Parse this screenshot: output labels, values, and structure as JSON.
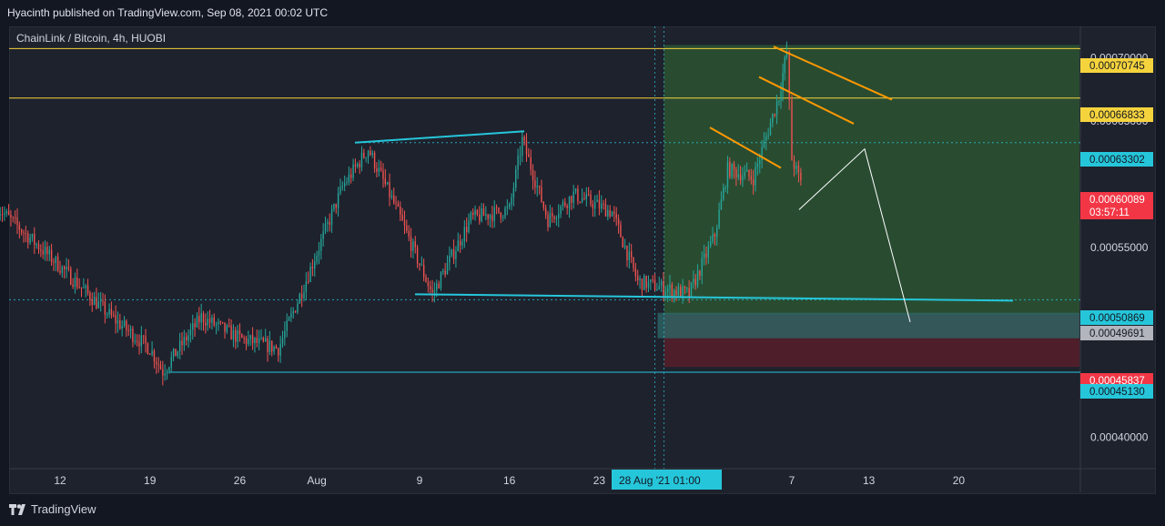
{
  "header": {
    "published": "Hyacinth published on TradingView.com, Sep 08, 2021 00:02 UTC"
  },
  "footer": {
    "brand": "TradingView"
  },
  "colors": {
    "background": "#1e222d",
    "up": "#26a69a",
    "down": "#ef5350",
    "yellow": "#f5d33d",
    "cyan": "#26c6da",
    "orange": "#ff9800",
    "white": "#ffffff",
    "profit_zone": "#2e5b33",
    "loss_zone": "#5a1f2a",
    "entry_band": "#2c6b6a"
  },
  "chart_data": {
    "type": "candlestick",
    "title": "ChainLink / Bitcoin, 4h, HUOBI",
    "y_axis": {
      "ticks": [
        "0.00070000",
        "0.00065000",
        "0.00055000",
        "0.00040000"
      ],
      "range": [
        0.000375,
        0.000725
      ]
    },
    "x_axis": {
      "ticks": [
        "12",
        "19",
        "26",
        "Aug",
        "9",
        "16",
        "23",
        "7",
        "13",
        "20"
      ],
      "crosshair_label": "28 Aug '21   01:00"
    },
    "price_labels": [
      {
        "value": "0.00070745",
        "kind": "yellow"
      },
      {
        "value": "0.00066833",
        "kind": "yellow"
      },
      {
        "value": "0.00063302",
        "kind": "cyan"
      },
      {
        "value": "0.00060089",
        "kind": "red",
        "sub": "03:57:11"
      },
      {
        "value": "0.00050869",
        "kind": "cyan"
      },
      {
        "value": "0.00049691",
        "kind": "gray"
      },
      {
        "value": "0.00045837",
        "kind": "red"
      },
      {
        "value": "0.00045130",
        "kind": "cyan"
      }
    ],
    "horizontal_levels": [
      0.00070745,
      0.00066833,
      0.00063302,
      0.00050869,
      0.0004513
    ],
    "series": [
      {
        "date": "Jul 07",
        "price": 0.000583
      },
      {
        "date": "Jul 12",
        "price": 0.000535
      },
      {
        "date": "Jul 16",
        "price": 0.000495
      },
      {
        "date": "Jul 19",
        "price": 0.00047
      },
      {
        "date": "Jul 20",
        "price": 0.000452
      },
      {
        "date": "Jul 23",
        "price": 0.000495
      },
      {
        "date": "Jul 26",
        "price": 0.000478
      },
      {
        "date": "Jul 29",
        "price": 0.00047
      },
      {
        "date": "Jul 31",
        "price": 0.00052
      },
      {
        "date": "Aug 03",
        "price": 0.000598
      },
      {
        "date": "Aug 05",
        "price": 0.000628
      },
      {
        "date": "Aug 07",
        "price": 0.000585
      },
      {
        "date": "Aug 10",
        "price": 0.000513
      },
      {
        "date": "Aug 13",
        "price": 0.000573
      },
      {
        "date": "Aug 16",
        "price": 0.00058
      },
      {
        "date": "Aug 17",
        "price": 0.000635
      },
      {
        "date": "Aug 19",
        "price": 0.000572
      },
      {
        "date": "Aug 21",
        "price": 0.000592
      },
      {
        "date": "Aug 24",
        "price": 0.000578
      },
      {
        "date": "Aug 26",
        "price": 0.000523
      },
      {
        "date": "Aug 28",
        "price": 0.000518
      },
      {
        "date": "Aug 30",
        "price": 0.000513
      },
      {
        "date": "Sep 01",
        "price": 0.00056
      },
      {
        "date": "Sep 02",
        "price": 0.000612
      },
      {
        "date": "Sep 04",
        "price": 0.000605
      },
      {
        "date": "Sep 06",
        "price": 0.00067
      },
      {
        "date": "Sep 06",
        "price": 0.000705
      },
      {
        "date": "Sep 07",
        "price": 0.00062
      },
      {
        "date": "Sep 07",
        "price": 0.000601
      }
    ],
    "annotations": {
      "position_entry": 0.00049691,
      "position_target": 0.00070745,
      "position_stop": 0.00045837
    }
  }
}
